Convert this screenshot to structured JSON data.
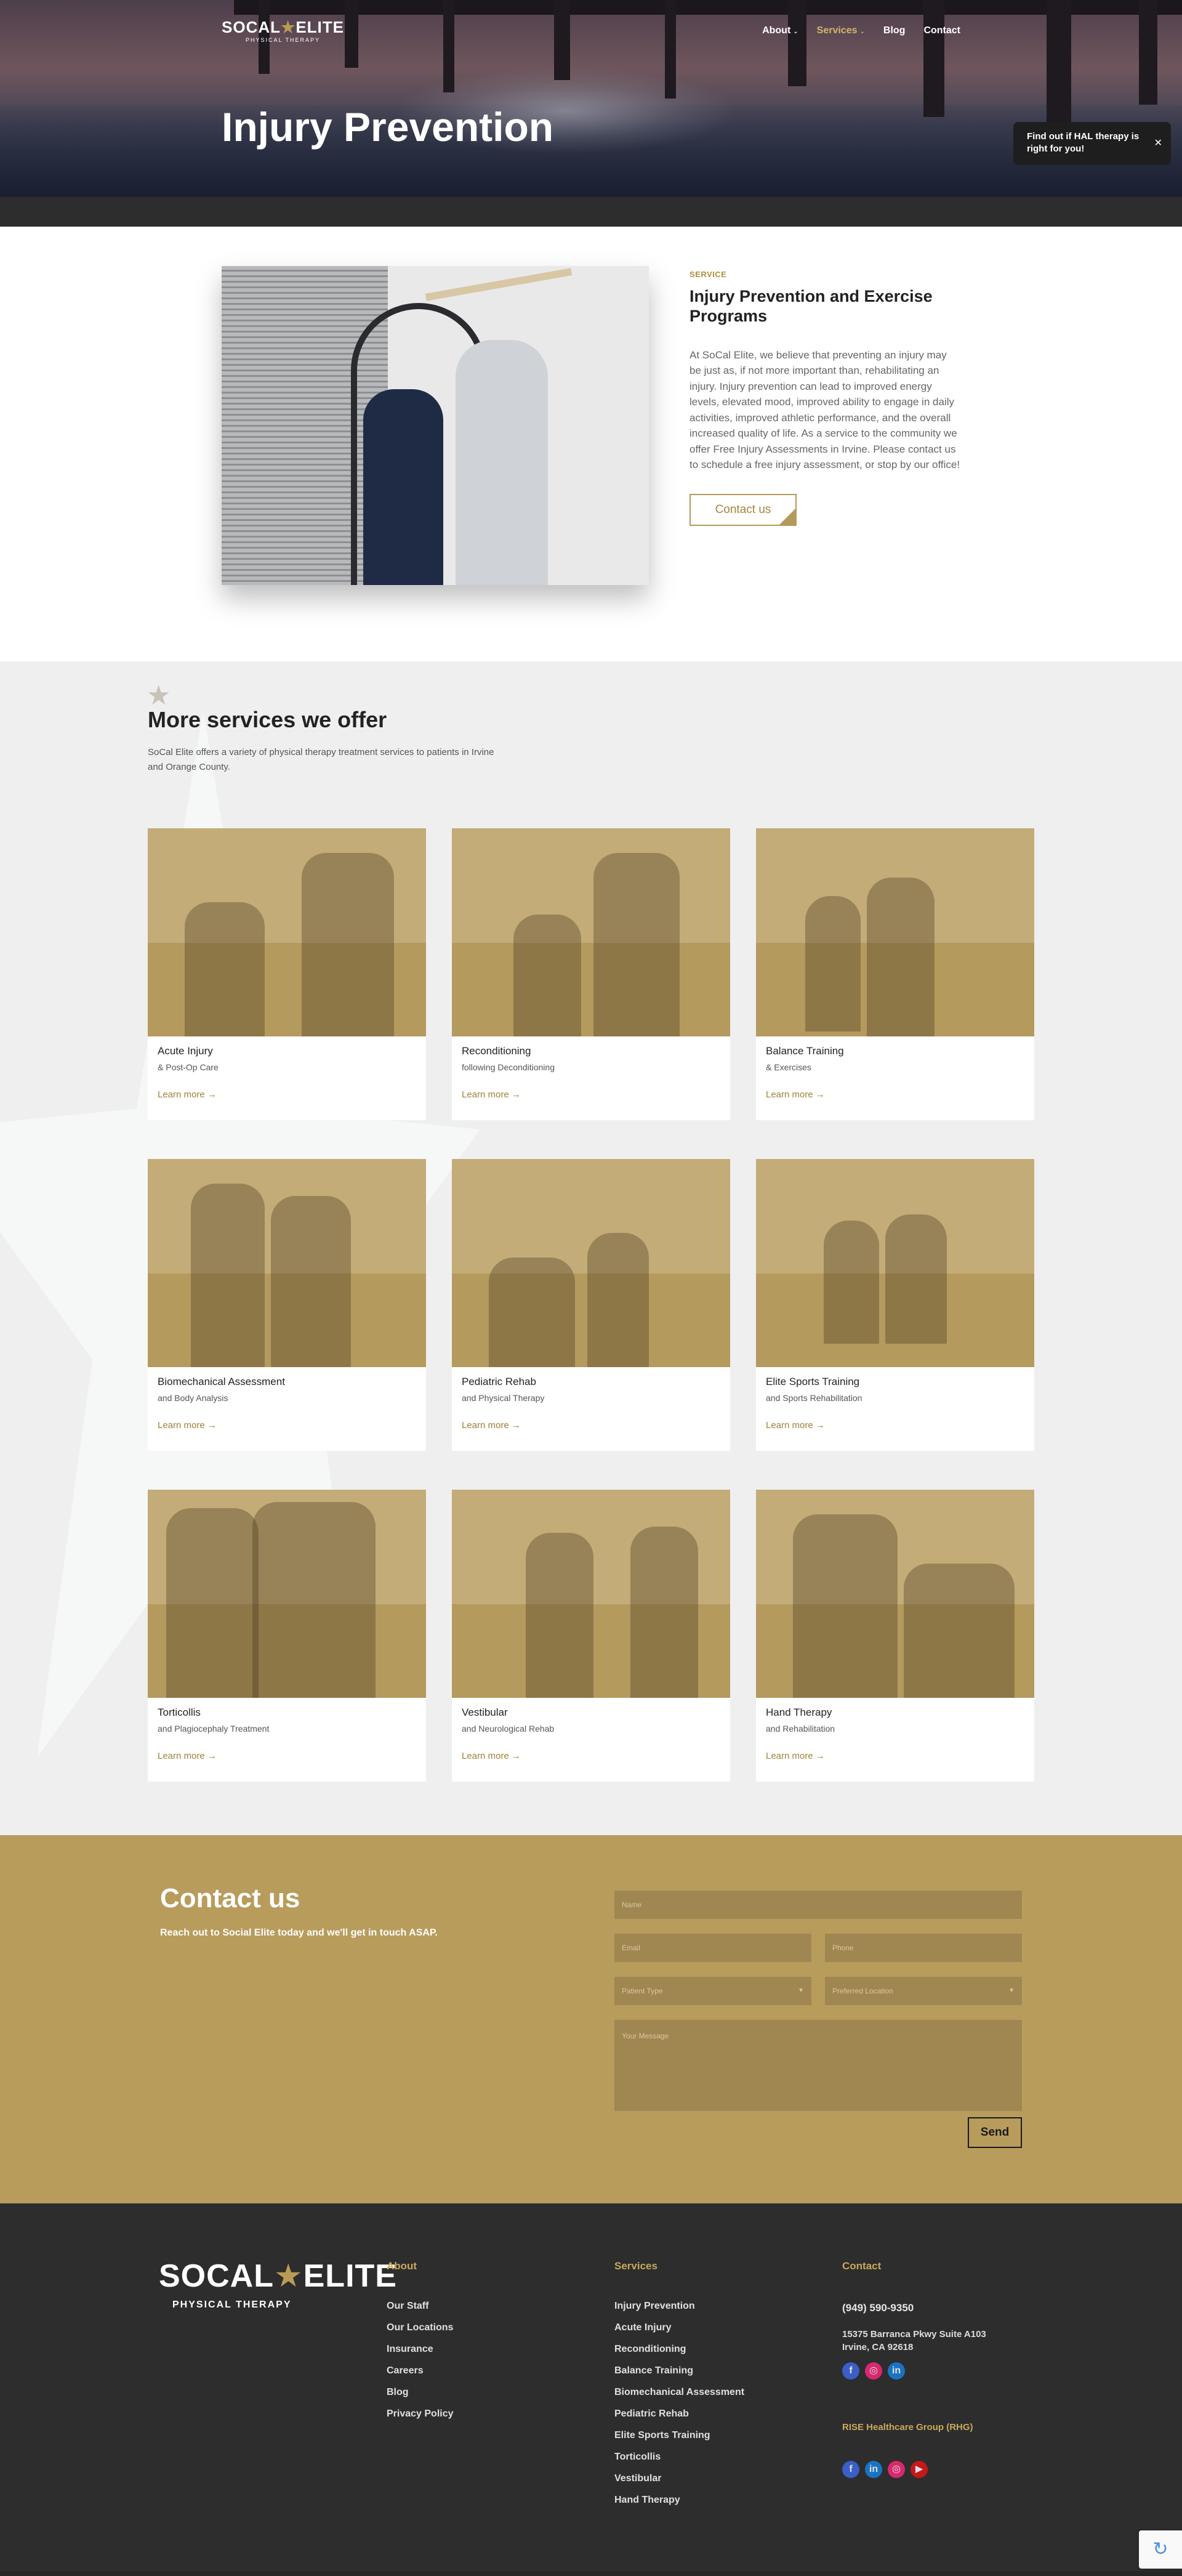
{
  "header": {
    "logo": {
      "main_left": "SOCAL",
      "main_right": "ELITE",
      "star": "★",
      "sub": "PHYSICAL THERAPY"
    },
    "nav": [
      {
        "label": "About",
        "caret": "⌄"
      },
      {
        "label": "Services",
        "caret": "⌄",
        "active": true
      },
      {
        "label": "Blog"
      },
      {
        "label": "Contact"
      }
    ],
    "hero_title": "Injury Prevention",
    "popup": {
      "text": "Find out if HAL therapy is right for you!",
      "close": "✕"
    }
  },
  "service": {
    "eyebrow": "SERVICE",
    "heading": "Injury Prevention and Exercise Programs",
    "body": "At SoCal Elite, we believe that preventing an injury may be just as, if not more important than, rehabilitating an injury. Injury prevention can lead to improved energy levels, elevated mood, improved ability to engage in daily activities, improved athletic performance, and the overall increased quality of life. As a service to the community we offer Free Injury Assessments in Irvine. Please contact us to schedule a free injury assessment, or stop by our office!",
    "button": "Contact us"
  },
  "more_services": {
    "star": "★",
    "heading": "More services we offer",
    "intro": "SoCal Elite offers a variety of physical therapy treatment services to patients in Irvine and Orange County.",
    "cards": [
      {
        "title": "Acute Injury",
        "sub": "& Post-Op Care",
        "link": "Learn more →"
      },
      {
        "title": "Reconditioning",
        "sub": "following Deconditioning",
        "link": "Learn more →"
      },
      {
        "title": "Balance Training",
        "sub": "& Exercises",
        "link": "Learn more →"
      },
      {
        "title": "Biomechanical Assessment",
        "sub": "and Body Analysis",
        "link": "Learn more →"
      },
      {
        "title": "Pediatric Rehab",
        "sub": "and Physical Therapy",
        "link": "Learn more →"
      },
      {
        "title": "Elite Sports Training",
        "sub": "and Sports Rehabilitation",
        "link": "Learn more →"
      },
      {
        "title": "Torticollis",
        "sub": "and Plagiocephaly Treatment",
        "link": "Learn more →"
      },
      {
        "title": "Vestibular",
        "sub": "and Neurological Rehab",
        "link": "Learn more →"
      },
      {
        "title": "Hand Therapy",
        "sub": "and Rehabilitation",
        "link": "Learn more →"
      }
    ]
  },
  "contact": {
    "heading": "Contact us",
    "sub": "Reach out to Social Elite today and we'll get in touch ASAP.",
    "fields": {
      "name": "Name",
      "email": "Email",
      "phone": "Phone",
      "patient_type": "Patient Type",
      "preferred_location": "Preferred Location",
      "message": "Your Message"
    },
    "select_caret": "▼",
    "send": "Send"
  },
  "footer": {
    "logo": {
      "main_left": "SOCAL",
      "main_right": "ELITE",
      "star": "★",
      "sub": "PHYSICAL THERAPY"
    },
    "about": {
      "heading": "About",
      "links": [
        "Our Staff",
        "Our Locations",
        "Insurance",
        "Careers",
        "Blog",
        "Privacy Policy"
      ]
    },
    "services": {
      "heading": "Services",
      "links": [
        "Injury Prevention",
        "Acute Injury",
        "Reconditioning",
        "Balance Training",
        "Biomechanical Assessment",
        "Pediatric Rehab",
        "Elite Sports Training",
        "Torticollis",
        "Vestibular",
        "Hand Therapy"
      ]
    },
    "contact": {
      "heading": "Contact",
      "phone": "(949) 590-9350",
      "address_line1": "15375 Barranca Pkwy Suite A103",
      "address_line2": "Irvine, CA 92618",
      "rise": "RISE Healthcare Group (RHG)"
    },
    "social": {
      "facebook": "f",
      "instagram": "◎",
      "linkedin": "in",
      "youtube": "▶"
    }
  },
  "recaptcha": {
    "icon": "↻"
  },
  "colors": {
    "gold": "#b89c5c",
    "dark": "#2d2d2d",
    "accent_text": "#a8843a"
  },
  "icons": [
    "caret-down-icon",
    "close-icon",
    "star-icon",
    "arrow-right-icon",
    "facebook-icon",
    "instagram-icon",
    "linkedin-icon",
    "youtube-icon",
    "recaptcha-icon"
  ]
}
